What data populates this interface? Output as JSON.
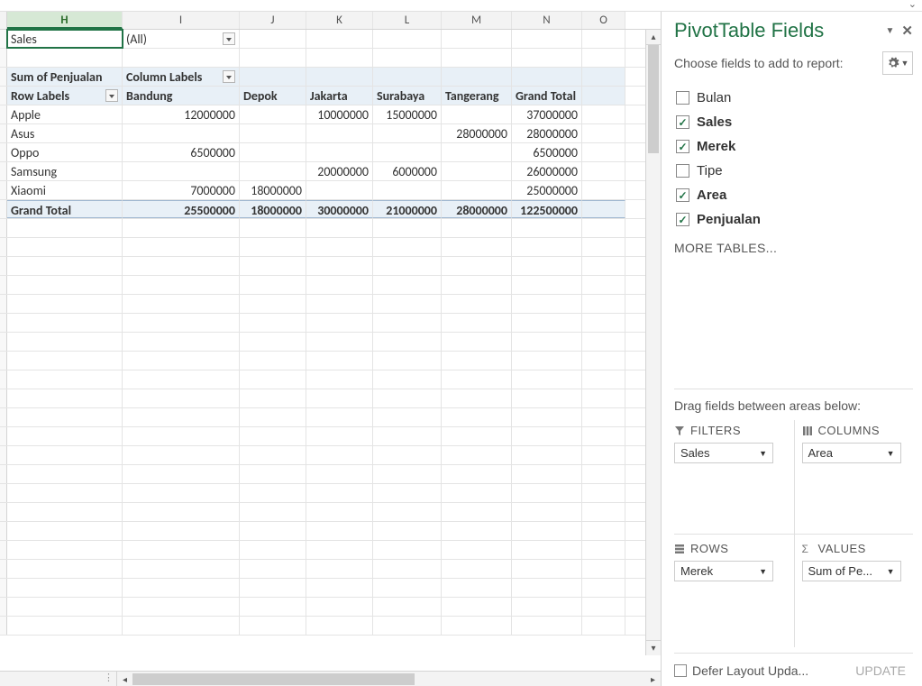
{
  "columns": {
    "headers": [
      "H",
      "I",
      "J",
      "K",
      "L",
      "M",
      "N",
      "O"
    ],
    "widths": [
      128,
      130,
      74,
      74,
      76,
      78,
      78,
      48
    ],
    "selected_index": 0
  },
  "filter_row": {
    "label": "Sales",
    "value": "(All)"
  },
  "pivot_header": {
    "sum_label": "Sum of Penjualan",
    "col_labels": "Column Labels",
    "row_labels": "Row Labels",
    "cities": [
      "Bandung",
      "Depok",
      "Jakarta",
      "Surabaya",
      "Tangerang",
      "Grand Total"
    ]
  },
  "data_rows": [
    {
      "label": "Apple",
      "v": [
        "12000000",
        "",
        "10000000",
        "15000000",
        "",
        "37000000"
      ]
    },
    {
      "label": "Asus",
      "v": [
        "",
        "",
        "",
        "",
        "28000000",
        "28000000"
      ]
    },
    {
      "label": "Oppo",
      "v": [
        "6500000",
        "",
        "",
        "",
        "",
        "6500000"
      ]
    },
    {
      "label": "Samsung",
      "v": [
        "",
        "",
        "20000000",
        "6000000",
        "",
        "26000000"
      ]
    },
    {
      "label": "Xiaomi",
      "v": [
        "7000000",
        "18000000",
        "",
        "",
        "",
        "25000000"
      ]
    }
  ],
  "grand_total": {
    "label": "Grand Total",
    "v": [
      "25500000",
      "18000000",
      "30000000",
      "21000000",
      "28000000",
      "122500000"
    ]
  },
  "pane": {
    "title": "PivotTable Fields",
    "subtext": "Choose fields to add to report:",
    "fields": [
      {
        "label": "Bulan",
        "checked": false
      },
      {
        "label": "Sales",
        "checked": true
      },
      {
        "label": "Merek",
        "checked": true
      },
      {
        "label": "Tipe",
        "checked": false
      },
      {
        "label": "Area",
        "checked": true
      },
      {
        "label": "Penjualan",
        "checked": true
      }
    ],
    "more_tables": "MORE TABLES...",
    "drag_label": "Drag fields between areas below:",
    "areas": {
      "filters": {
        "title": "FILTERS",
        "item": "Sales"
      },
      "columns": {
        "title": "COLUMNS",
        "item": "Area"
      },
      "rows": {
        "title": "ROWS",
        "item": "Merek"
      },
      "values": {
        "title": "VALUES",
        "item": "Sum of Pe..."
      }
    },
    "defer_label": "Defer Layout Upda...",
    "update_label": "UPDATE"
  }
}
